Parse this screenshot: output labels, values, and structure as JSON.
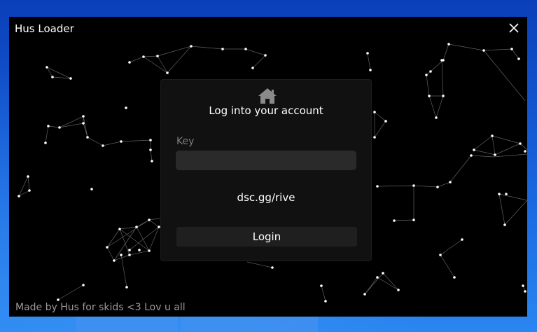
{
  "window": {
    "title": "Hus Loader",
    "close_icon": "close-icon",
    "footer_text": "Made by Hus for skids <3 Lov u all"
  },
  "login_panel": {
    "icon": "home-icon",
    "heading": "Log into your account",
    "key_label": "Key",
    "key_value": "",
    "invite_text": "dsc.gg/rive",
    "login_label": "Login"
  },
  "colors": {
    "window_bg": "#000000",
    "panel_bg": "#111111",
    "input_bg": "#2a2a2a",
    "button_bg": "#1f1f1f",
    "desktop_bg": "#1a68e0",
    "muted_text": "#9a9a9a"
  }
}
